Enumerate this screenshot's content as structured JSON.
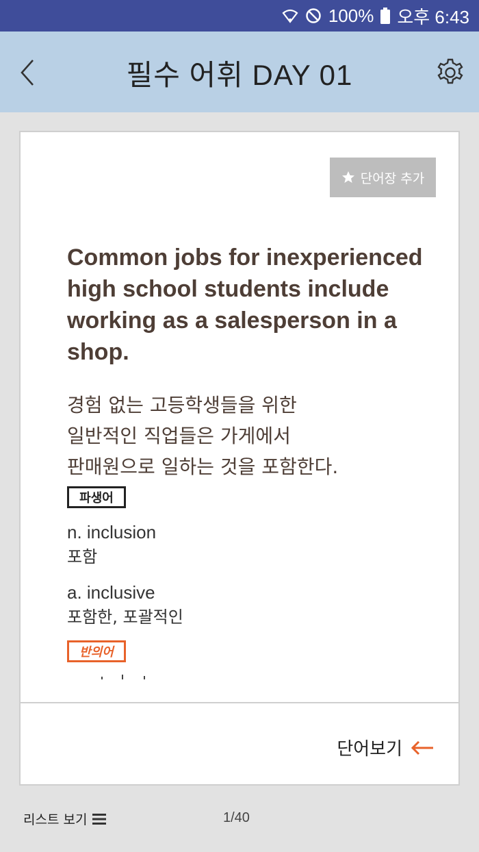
{
  "status_bar": {
    "battery": "100%",
    "time": "오후 6:43"
  },
  "header": {
    "title": "필수 어휘 DAY 01"
  },
  "card": {
    "bookmark_label": "단어장 추가",
    "sentence": "Common jobs for inexperienced high school students include working as a salesperson in a shop.",
    "translation_lines": [
      "경험 없는 고등학생들을 위한",
      "일반적인 직업들은 가게에서",
      "판매원으로 일하는 것을 포함한다."
    ],
    "derived_tag": "파생어",
    "derivatives": [
      {
        "word": "n. inclusion",
        "meaning": "포함"
      },
      {
        "word": "a. inclusive",
        "meaning": "포함한, 포괄적인"
      }
    ],
    "antonym_tag": "반의어",
    "view_word_label": "단어보기"
  },
  "footer": {
    "list_view_label": "리스트 보기",
    "page_counter": "1/40"
  },
  "colors": {
    "status_bar": "#3f4d9a",
    "app_bar": "#b9d0e5",
    "accent": "#e8622a",
    "sentence_text": "#4e3e36"
  }
}
